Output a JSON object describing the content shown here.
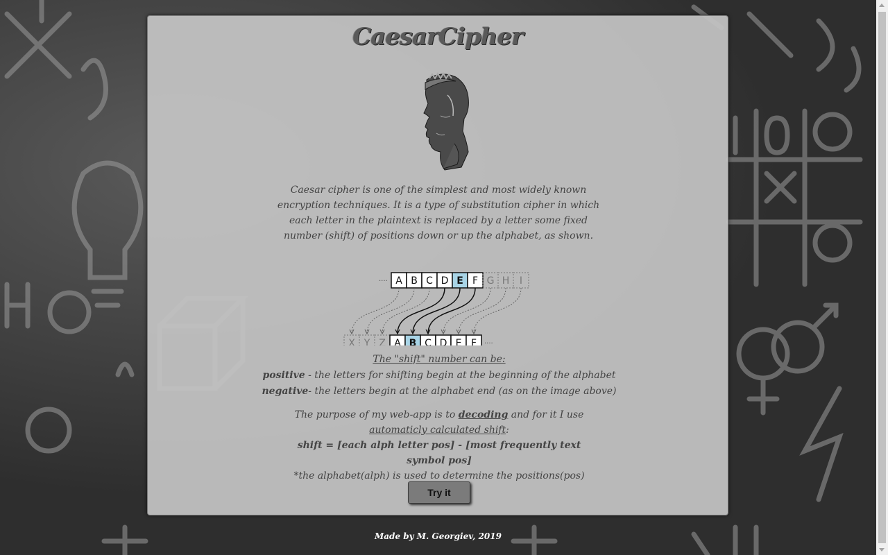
{
  "app": {
    "title": "CaesarCipher"
  },
  "description": "Caesar cipher is one of the simplest and most widely known encryption techniques. It is a type of substitution cipher in which each letter in the plaintext is replaced by a letter some fixed number (shift) of positions down or up the alphabet, as shown.",
  "diagram": {
    "top_dots": "....",
    "top_letters": [
      "A",
      "B",
      "C",
      "D",
      "E",
      "F"
    ],
    "top_faded": [
      "G",
      "H",
      "I"
    ],
    "top_highlight": "E",
    "bottom_faded": [
      "X",
      "Y",
      "Z"
    ],
    "bottom_letters": [
      "A",
      "B",
      "C",
      "D",
      "E",
      "F"
    ],
    "bottom_highlight": "B",
    "bottom_dots": "....",
    "highlight_color": "#a8d4e6"
  },
  "shift_info": {
    "title": "The \"shift\" number can be:",
    "positive_label": "positive",
    "positive_text": " - the letters for shifting begin at the beginning of the alphabet",
    "negative_label": "negative",
    "negative_text": "- the letters begin at the alphabet end (as on the image above)"
  },
  "purpose": {
    "text_1": "The purpose of my web-app is to ",
    "decoding": "decoding",
    "text_2": " and for it I use ",
    "auto_shift": "automaticly calculated shift",
    "colon": ":",
    "formula": "shift = [each alph letter pos] - [most frequently text symbol pos]",
    "note": "*the alphabet(alph) is used to determine the positions(pos)"
  },
  "button": {
    "try_label": "Try it"
  },
  "footer": {
    "text": "Made by M. Georgiev, 2019"
  },
  "colors": {
    "panel": "#c4c4c4",
    "button": "#7b7b7b",
    "background": "#2e2e2e"
  }
}
